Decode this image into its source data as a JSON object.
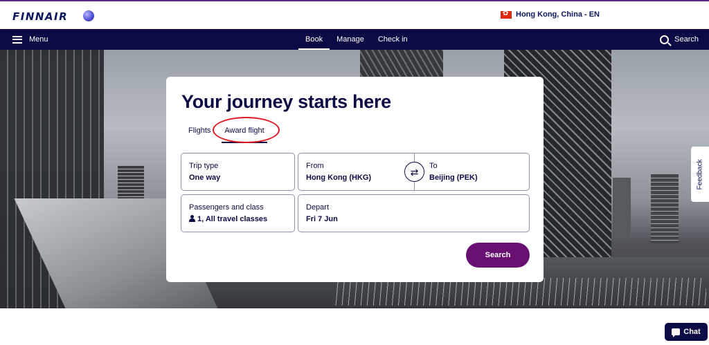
{
  "header": {
    "logo": "FINNAIR",
    "logo_mark_icon": "moon-logo-icon",
    "locale": "Hong Kong, China - EN",
    "locale_flag_icon": "hong-kong-flag-icon"
  },
  "nav": {
    "menu_label": "Menu",
    "menu_icon": "hamburger-icon",
    "tabs": [
      {
        "label": "Book",
        "active": true
      },
      {
        "label": "Manage",
        "active": false
      },
      {
        "label": "Check in",
        "active": false
      }
    ],
    "search_label": "Search",
    "search_icon": "search-icon"
  },
  "card": {
    "title": "Your journey starts here",
    "tabs": [
      {
        "label": "Flights",
        "active": false
      },
      {
        "label": "Award flight",
        "active": true
      }
    ],
    "trip_type": {
      "label": "Trip type",
      "value": "One way"
    },
    "from": {
      "label": "From",
      "value": "Hong Kong (HKG)"
    },
    "to": {
      "label": "To",
      "value": "Beijing (PEK)"
    },
    "passengers": {
      "label": "Passengers and class",
      "value": "1, All travel classes"
    },
    "depart": {
      "label": "Depart",
      "value": "Fri 7 Jun"
    },
    "search_button": "Search",
    "swap_icon": "swap-arrows-icon"
  },
  "feedback_label": "Feedback",
  "chat_label": "Chat",
  "colors": {
    "brand_navy": "#0b0a45",
    "search_button": "#6a0f72",
    "highlight_circle": "#e0171f"
  }
}
